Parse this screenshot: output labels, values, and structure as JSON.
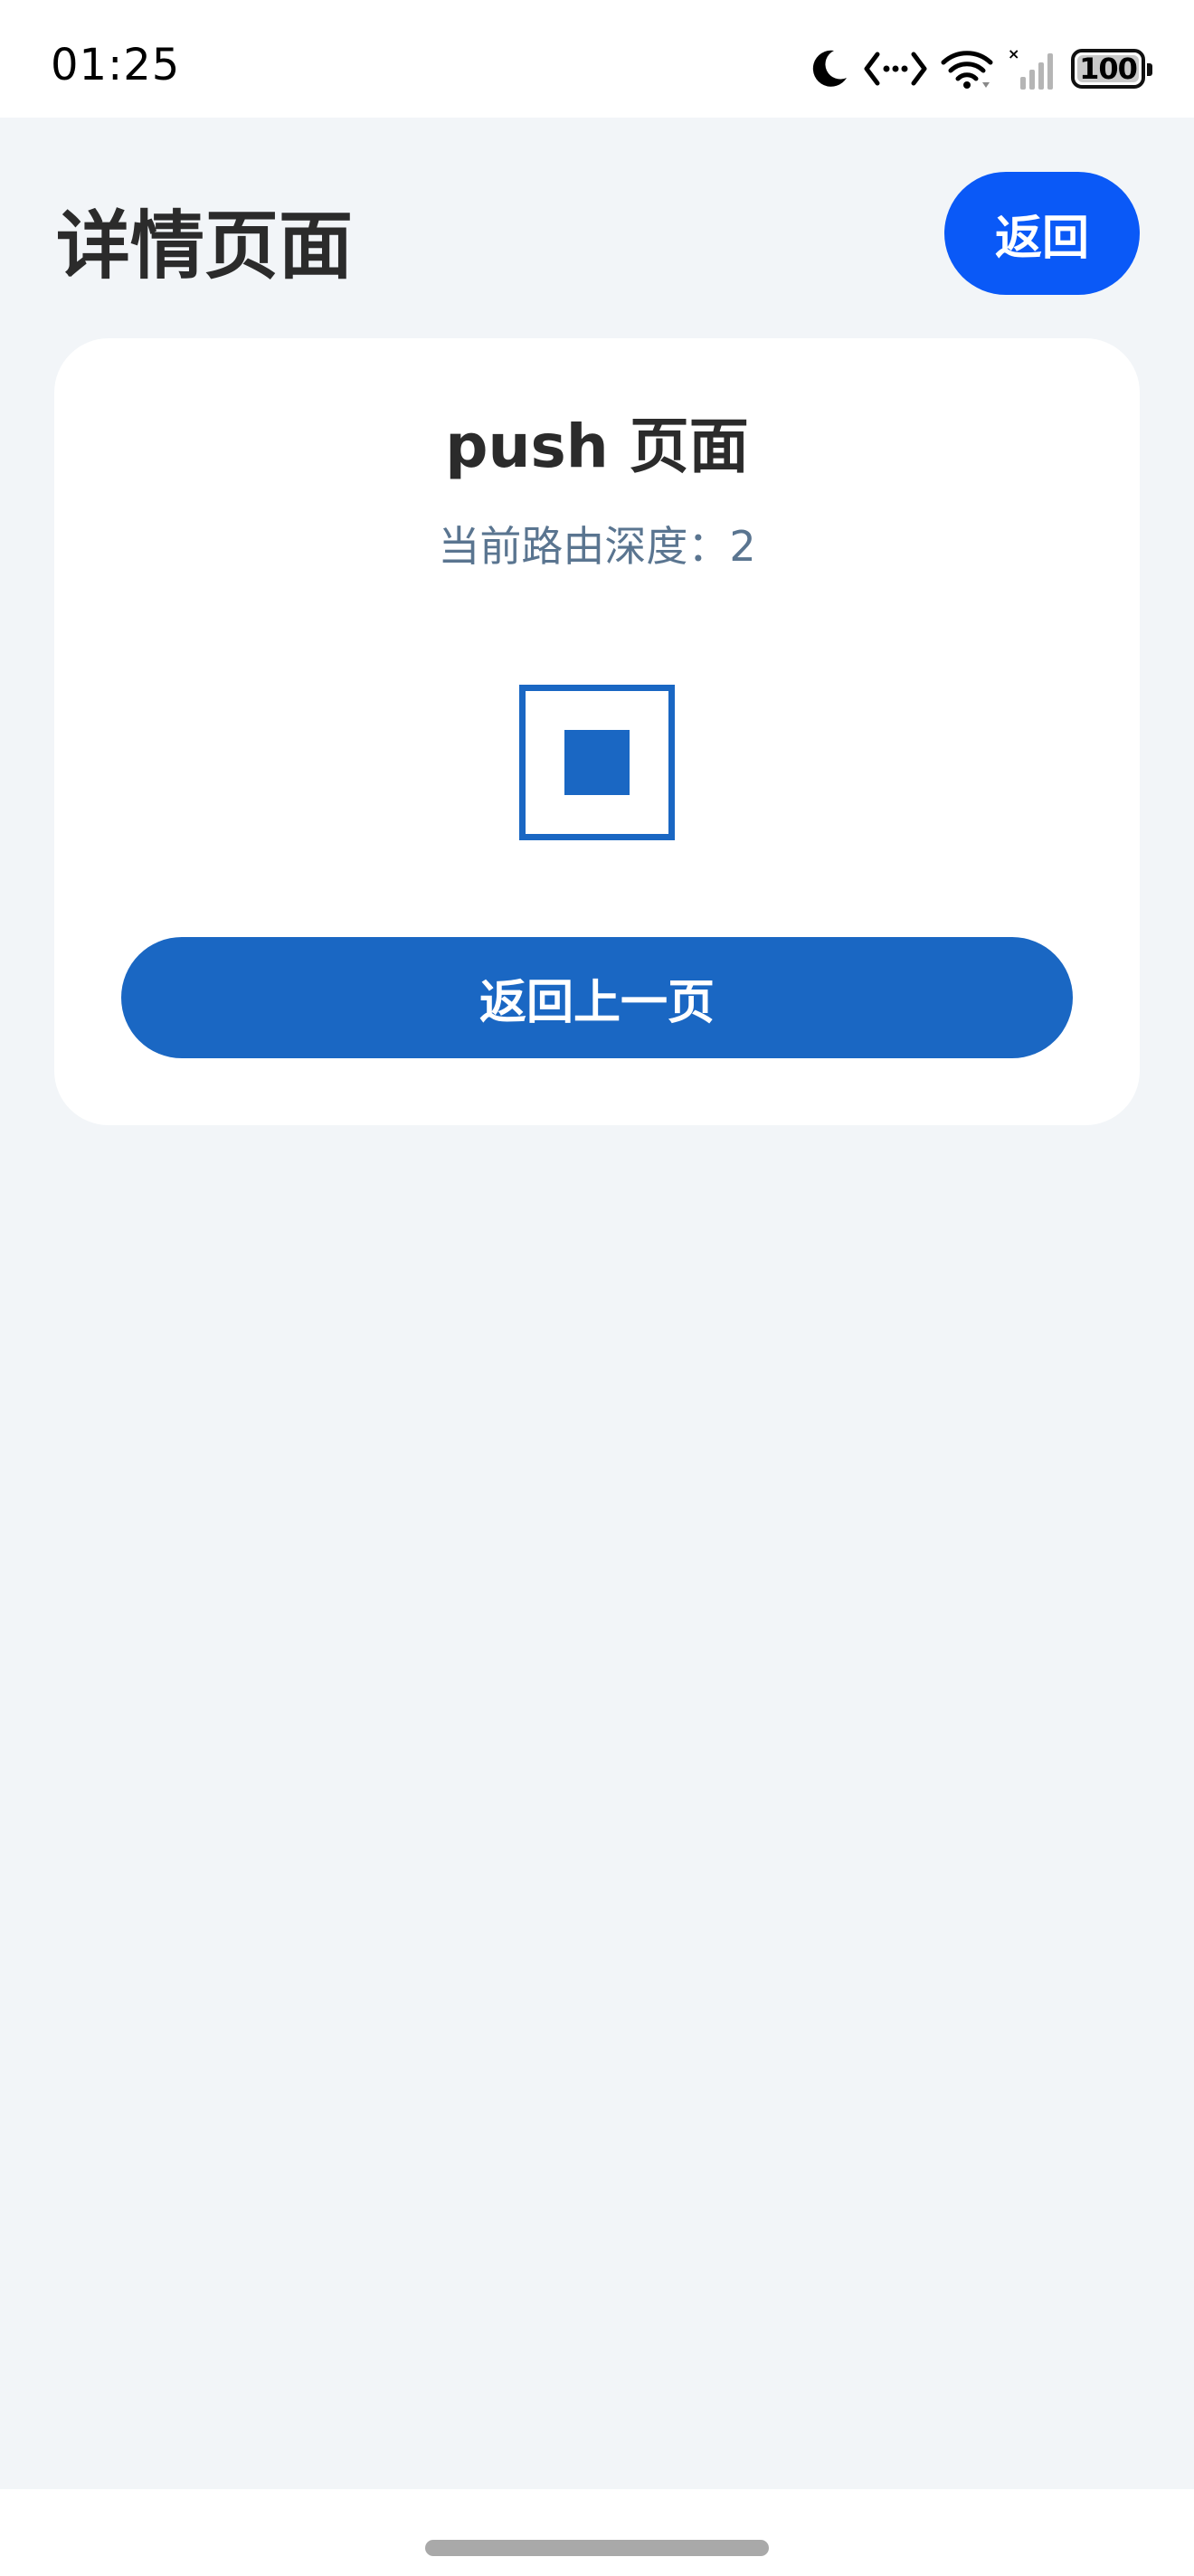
{
  "status_bar": {
    "time": "01:25",
    "battery_level": "100",
    "icons": [
      "moon-icon",
      "code-icon",
      "wifi-icon",
      "signal-icon",
      "battery-icon"
    ]
  },
  "header": {
    "title": "详情页面",
    "back_label": "返回"
  },
  "card": {
    "title": "push 页面",
    "subtitle": "当前路由深度：2",
    "icon": "stop-square-icon",
    "button_label": "返回上一页"
  },
  "colors": {
    "background": "#f2f5f8",
    "card_bg": "#ffffff",
    "header_button": "#0a59f7",
    "primary": "#1a67c3",
    "title_text": "#2b2b2b",
    "subtitle_text": "#5a7590"
  }
}
